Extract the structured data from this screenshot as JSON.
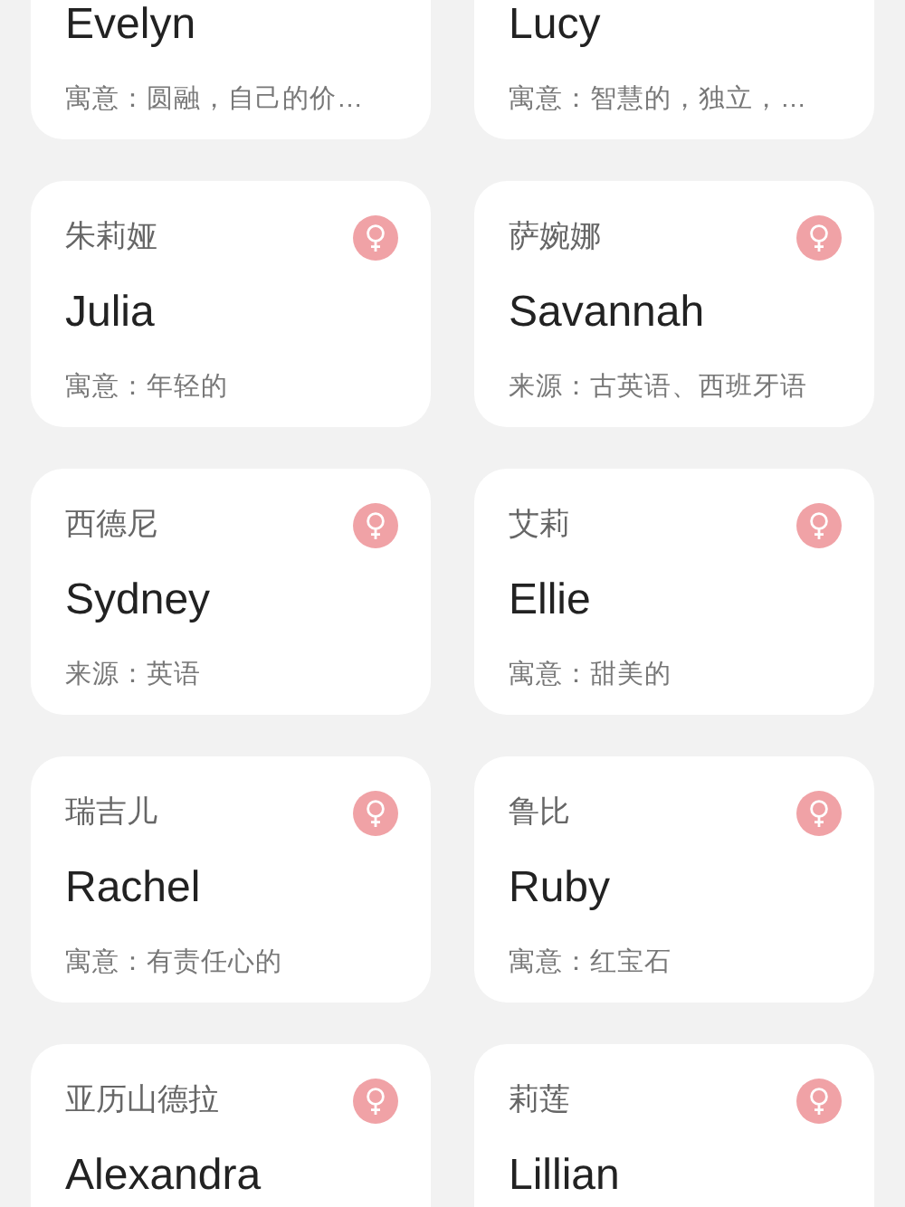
{
  "cards": [
    {
      "english_name": "Evelyn",
      "note": "寓意：圆融，自己的价…"
    },
    {
      "english_name": "Lucy",
      "note": "寓意：智慧的，独立，…"
    },
    {
      "chinese_name": "朱莉娅",
      "english_name": "Julia",
      "note": "寓意：年轻的"
    },
    {
      "chinese_name": "萨婉娜",
      "english_name": "Savannah",
      "note": "来源：古英语、西班牙语"
    },
    {
      "chinese_name": "西德尼",
      "english_name": "Sydney",
      "note": "来源：英语"
    },
    {
      "chinese_name": "艾莉",
      "english_name": "Ellie",
      "note": "寓意：甜美的"
    },
    {
      "chinese_name": "瑞吉儿",
      "english_name": "Rachel",
      "note": "寓意：有责任心的"
    },
    {
      "chinese_name": "鲁比",
      "english_name": "Ruby",
      "note": "寓意：红宝石"
    },
    {
      "chinese_name": "亚历山德拉",
      "english_name": "Alexandra"
    },
    {
      "chinese_name": "莉莲",
      "english_name": "Lillian"
    }
  ]
}
